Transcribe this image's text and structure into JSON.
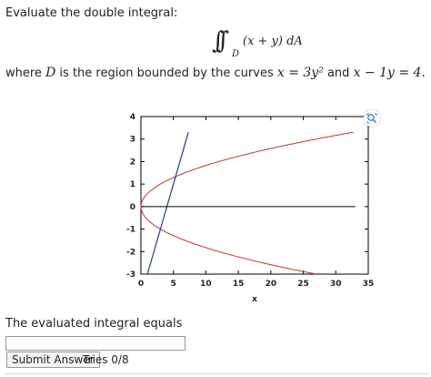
{
  "question": {
    "prompt": "Evaluate the double integral:",
    "integral_signs": "∫∫",
    "integral_subscript": "D",
    "integrand": "(x + y) dA",
    "region_prefix": "where ",
    "region_symbol": "D",
    "region_text": " is the region bounded by the curves ",
    "curve1": "x = 3y²",
    "connector": " and ",
    "curve2": "x − 1y = 4."
  },
  "chart_data": {
    "type": "line",
    "xlabel": "x",
    "ylabel": "",
    "xlim": [
      0,
      35
    ],
    "ylim": [
      -3,
      4
    ],
    "x_ticks": [
      "0",
      "5",
      "10",
      "15",
      "20",
      "25",
      "30",
      "35"
    ],
    "y_ticks": [
      "-3",
      "-2",
      "-1",
      "0",
      "1",
      "2",
      "3",
      "4"
    ],
    "series": [
      {
        "curve": "x = 3y^2",
        "color": "#c0392b",
        "y_range": [
          -3,
          3.3
        ]
      },
      {
        "curve": "x - 1y = 4",
        "color": "#1f3a93",
        "y_range": [
          -3,
          3.3
        ]
      },
      {
        "curve": "y = 0",
        "color": "#000000",
        "x_range": [
          0,
          33
        ]
      }
    ],
    "grid": false
  },
  "answer": {
    "label": "The evaluated integral equals",
    "value": "",
    "submit_label": "Submit Answer",
    "tries": "Tries 0/8"
  },
  "icons": {
    "zoom": "zoom-icon"
  }
}
